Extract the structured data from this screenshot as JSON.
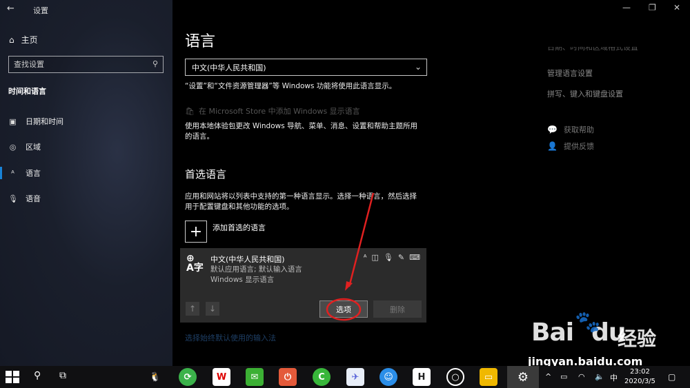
{
  "window": {
    "title": "设置",
    "controls": {
      "minimize": "—",
      "restore": "❐",
      "close": "✕"
    }
  },
  "sidebar": {
    "home_label": "主页",
    "search_placeholder": "查找设置",
    "section_title": "时间和语言",
    "items": [
      {
        "label": "日期和时间",
        "icon": "calendar-clock-icon"
      },
      {
        "label": "区域",
        "icon": "globe-icon"
      },
      {
        "label": "语言",
        "icon": "language-icon",
        "active": true
      },
      {
        "label": "语音",
        "icon": "microphone-icon"
      }
    ]
  },
  "main": {
    "title": "语言",
    "display_language": {
      "selected": "中文(中华人民共和国)",
      "description": "“设置”和“文件资源管理器”等 Windows 功能将使用此语言显示。"
    },
    "store_link": "在 Microsoft Store 中添加 Windows 显示语言",
    "local_experience_text_1": "使用本地体验包更改 Windows 导航、菜单、消息、设置和帮助主题所用",
    "local_experience_text_2": "的语言。",
    "preferred_title": "首选语言",
    "preferred_desc_1": "应用和网站将以列表中支持的第一种语言显示。选择一种语言，然后选择",
    "preferred_desc_2": "用于配置键盘和其他功能的选项。",
    "add_language_label": "添加首选的语言",
    "language_card": {
      "name": "中文(中华人民共和国)",
      "sub1": "默认应用语言; 默认输入语言",
      "sub2": "Windows 显示语言",
      "options_label": "选项",
      "delete_label": "删除"
    },
    "bottom_link": "选择始终默认使用的输入法"
  },
  "right_panel": {
    "partial_link": "日期、时间和区域格式设置",
    "links": [
      "管理语言设置",
      "拼写、键入和键盘设置"
    ],
    "help": [
      {
        "label": "获取帮助",
        "icon": "help-chat-icon"
      },
      {
        "label": "提供反馈",
        "icon": "feedback-icon"
      }
    ]
  },
  "watermark": {
    "logo": "Bai",
    "logo_tail": "du",
    "cn": "经验",
    "url": "jingyan.baidu.com"
  },
  "taskbar": {
    "ime": "中",
    "time": "23:02",
    "date": "2020/3/5"
  },
  "colors": {
    "accent": "#1883d7",
    "annotation": "#e02020",
    "card": "#2b2b2b"
  }
}
